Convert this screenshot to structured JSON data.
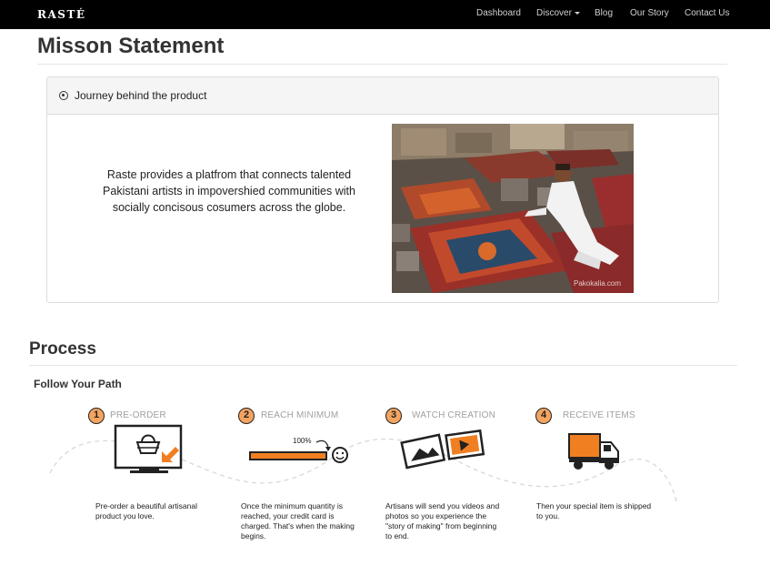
{
  "brand": "RASTÉ",
  "nav": {
    "dashboard": "Dashboard",
    "discover": "Discover",
    "blog": "Blog",
    "our_story": "Our Story",
    "contact": "Contact Us"
  },
  "mission": {
    "title": "Misson Statement",
    "panel_title": "Journey behind the product",
    "text": "Raste provides a platfrom that connects talented Pakistani artists in impovershied communities with socially concisous cosumers across the globe.",
    "photo_credit": "Pakokalia.com"
  },
  "process": {
    "title": "Process",
    "subtitle": "Follow Your Path",
    "steps": [
      {
        "num": "1",
        "title": "PRE-ORDER",
        "desc": "Pre-order a beautiful artisanal product you love."
      },
      {
        "num": "2",
        "title": "REACH MINIMUM",
        "desc": "Once the minimum quantity is reached, your credit card is charged. That's when the making begins."
      },
      {
        "num": "3",
        "title": "WATCH CREATION",
        "desc": "Artisans will send you videos and photos so you experience the \"story of making\" from beginning to end."
      },
      {
        "num": "4",
        "title": "RECEIVE ITEMS",
        "desc": "Then your special item is shipped to you."
      }
    ],
    "progress_label": "100%",
    "progress_value": 1.0
  },
  "colors": {
    "accent": "#f07f22",
    "step_circle": "#f4a460",
    "navbar": "#000000"
  },
  "icons": [
    "computer-basket-icon",
    "progress-bar-icon",
    "smiley-icon",
    "photo-video-icon",
    "truck-icon"
  ]
}
